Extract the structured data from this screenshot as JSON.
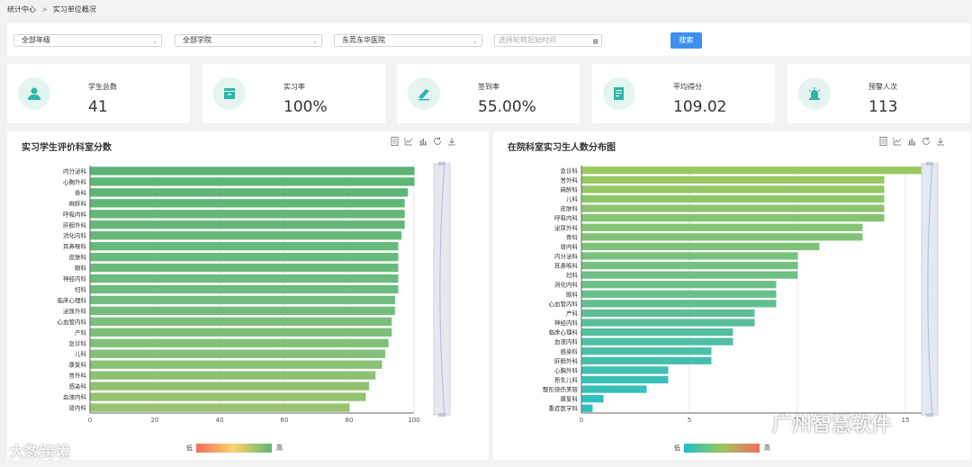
{
  "breadcrumb": {
    "home": "统计中心",
    "sep": ">",
    "current": "实习单位概况"
  },
  "filters": {
    "grade": "全部年级",
    "college": "全部学院",
    "hospital": "东莞东华医院",
    "date_placeholder": "选择轮转起始时间",
    "search_label": "搜索"
  },
  "stats": [
    {
      "label": "学生总数",
      "value": "41",
      "icon": "students-icon"
    },
    {
      "label": "实习率",
      "value": "100%",
      "icon": "inbox-icon"
    },
    {
      "label": "签到率",
      "value": "55.00%",
      "icon": "sign-icon"
    },
    {
      "label": "平均得分",
      "value": "109.02",
      "icon": "score-icon"
    },
    {
      "label": "预警人次",
      "value": "113",
      "icon": "alarm-icon"
    }
  ],
  "chart_data": [
    {
      "type": "bar",
      "orientation": "horizontal",
      "title": "实习学生评价科室分数",
      "categories": [
        "内分泌科",
        "心胸外科",
        "骨科",
        "麻醉科",
        "呼吸内科",
        "肝胆外科",
        "消化内科",
        "耳鼻喉科",
        "皮肤科",
        "眼科",
        "神经内科",
        "妇科",
        "临床心理科",
        "泌尿外科",
        "心血管内科",
        "产科",
        "急诊科",
        "儿科",
        "康复科",
        "普外科",
        "感染科",
        "血液内科",
        "肾内科"
      ],
      "values": [
        100,
        100,
        98,
        97,
        97,
        97,
        96,
        95,
        95,
        95,
        95,
        95,
        94,
        94,
        93,
        93,
        92,
        91,
        90,
        88,
        86,
        85,
        80
      ],
      "xlim": [
        0,
        100
      ],
      "xticks": [
        0,
        20,
        40,
        60,
        80,
        100
      ],
      "legend": {
        "low": "低",
        "high": "高"
      },
      "colors": [
        "#f46d5d",
        "#f9d56e",
        "#5cb574"
      ]
    },
    {
      "type": "bar",
      "orientation": "horizontal",
      "title": "在院科室实习生人数分布图",
      "categories": [
        "急诊科",
        "普外科",
        "麻醉科",
        "儿科",
        "皮肤科",
        "呼吸内科",
        "泌尿外科",
        "骨科",
        "肾内科",
        "内分泌科",
        "耳鼻喉科",
        "妇科",
        "消化内科",
        "眼科",
        "心血管内科",
        "产科",
        "神经内科",
        "临床心理科",
        "血液内科",
        "感染科",
        "肝胆外科",
        "心胸外科",
        "新生儿科",
        "整形烧伤美容",
        "康复科",
        "重症医学科"
      ],
      "values": [
        16,
        14,
        14,
        14,
        14,
        14,
        13,
        13,
        11,
        10,
        10,
        10,
        9,
        9,
        9,
        8,
        8,
        7,
        7,
        6,
        6,
        4,
        4,
        3,
        1,
        0.5
      ],
      "xlim": [
        0,
        16
      ],
      "xticks": [
        0,
        5,
        10,
        15
      ],
      "legend": {
        "low": "低",
        "high": "高"
      },
      "colors": [
        "#1fbfc2",
        "#9ac85f",
        "#f46d5d"
      ]
    }
  ],
  "tool_icons": [
    "doc-icon",
    "line-chart-icon",
    "bar-chart-icon",
    "refresh-icon",
    "download-icon"
  ],
  "watermarks": {
    "left": "大数跨境",
    "right": "广州智慧软件"
  }
}
